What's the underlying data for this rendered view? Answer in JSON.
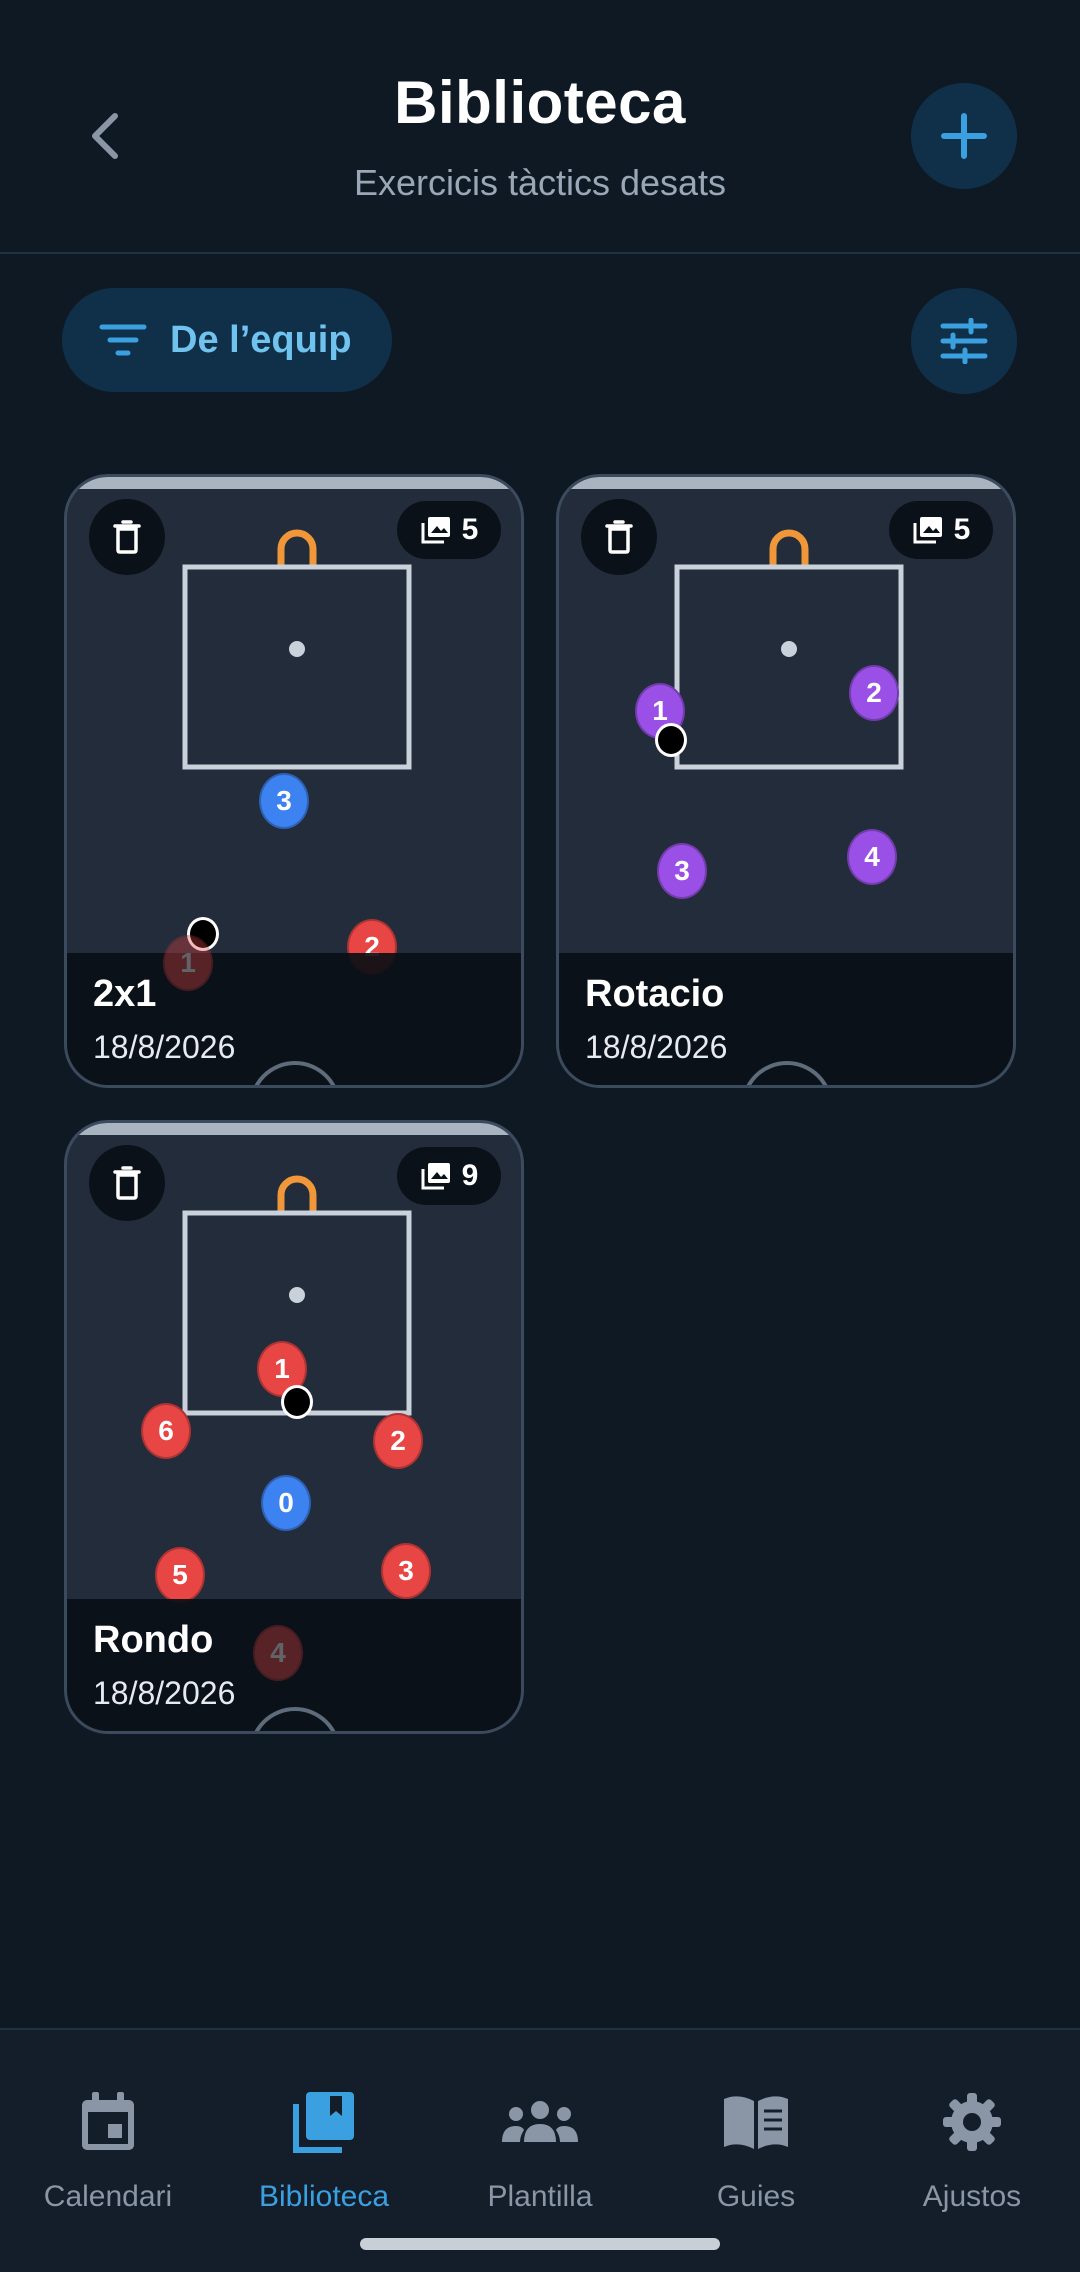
{
  "header": {
    "title": "Biblioteca",
    "subtitle": "Exercicis tàctics desats"
  },
  "filter": {
    "label": "De l’equip"
  },
  "cards": [
    {
      "name": "2x1",
      "date": "18/8/2026",
      "image_count": "5",
      "players": [
        {
          "label": "3",
          "team": "blue"
        },
        {
          "label": "1",
          "team": "red"
        },
        {
          "label": "2",
          "team": "red"
        }
      ]
    },
    {
      "name": "Rotacio",
      "date": "18/8/2026",
      "image_count": "5",
      "players": [
        {
          "label": "1",
          "team": "purple"
        },
        {
          "label": "2",
          "team": "purple"
        },
        {
          "label": "3",
          "team": "purple"
        },
        {
          "label": "4",
          "team": "purple"
        }
      ]
    },
    {
      "name": "Rondo",
      "date": "18/8/2026",
      "image_count": "9",
      "players": [
        {
          "label": "1",
          "team": "red"
        },
        {
          "label": "6",
          "team": "red"
        },
        {
          "label": "2",
          "team": "red"
        },
        {
          "label": "0",
          "team": "blue"
        },
        {
          "label": "5",
          "team": "red"
        },
        {
          "label": "3",
          "team": "red"
        },
        {
          "label": "4",
          "team": "red"
        }
      ]
    }
  ],
  "nav": {
    "items": [
      {
        "label": "Calendari",
        "icon": "calendar-icon",
        "active": false
      },
      {
        "label": "Biblioteca",
        "icon": "library-icon",
        "active": true
      },
      {
        "label": "Plantilla",
        "icon": "team-icon",
        "active": false
      },
      {
        "label": "Guies",
        "icon": "book-icon",
        "active": false
      },
      {
        "label": "Ajustos",
        "icon": "gear-icon",
        "active": false
      }
    ]
  },
  "colors": {
    "background": "#0f1923",
    "accent": "#3aa0e0",
    "card": "#222c3b",
    "team_red": "#e84545",
    "team_blue": "#3c82f0",
    "team_purple": "#9a50e6",
    "goal": "#f0973a"
  }
}
